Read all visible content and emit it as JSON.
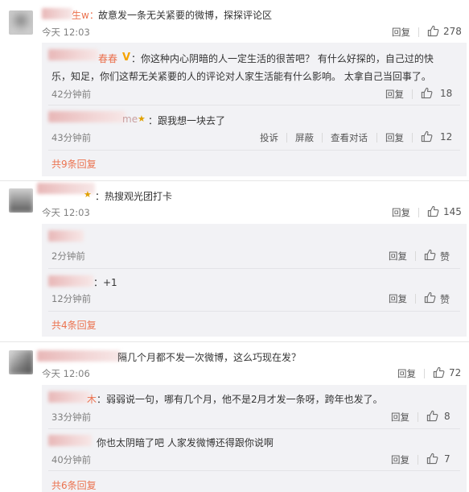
{
  "colors": {
    "accent": "#eb7350",
    "text": "#333333",
    "muted": "#808080",
    "reply_bg": "#f2f2f5"
  },
  "comments": [
    {
      "name_tail": "生w：",
      "text": "故意发一条无关紧要的微博，探探评论区",
      "time": "今天 12:03",
      "reply_label": "回复",
      "like_count": "278",
      "replies": [
        {
          "name_tail": "春春",
          "text_line1": "：你这种内心阴暗的人一定生活的很苦吧？ 有什么好探的，自己过的快",
          "text_line2": "乐，知足，你们这帮无关紧要的人的评论对人家生活能有什么影响。 太拿自己当回事了。",
          "time": "42分钟前",
          "reply_label": "回复",
          "like_count": "18"
        },
        {
          "name_tail": "me",
          "text": "：跟我想一块去了",
          "time": "43分钟前",
          "report_label": "投诉",
          "block_label": "屏蔽",
          "convo_label": "查看对话",
          "reply_label": "回复",
          "like_count": "12"
        }
      ],
      "more": "共9条回复"
    },
    {
      "text": "：热搜观光团打卡",
      "time": "今天 12:03",
      "reply_label": "回复",
      "like_count": "145",
      "replies": [
        {
          "text": "",
          "time": "2分钟前",
          "reply_label": "回复",
          "like_label": "赞"
        },
        {
          "text": "：+1",
          "time": "12分钟前",
          "reply_label": "回复",
          "like_label": "赞"
        }
      ],
      "more": "共4条回复"
    },
    {
      "text": "隔几个月都不发一次微博，这么巧现在发？",
      "time": "今天 12:06",
      "reply_label": "回复",
      "like_count": "72",
      "replies": [
        {
          "name_tail": "木",
          "text": "：弱弱说一句，哪有几个月，他不是2月才发一条呀，跨年也发了。",
          "time": "33分钟前",
          "reply_label": "回复",
          "like_count": "8"
        },
        {
          "text": "你也太阴暗了吧 人家发微博还得跟你说啊",
          "time": "40分钟前",
          "reply_label": "回复",
          "like_count": "7"
        }
      ],
      "more": "共6条回复"
    }
  ]
}
